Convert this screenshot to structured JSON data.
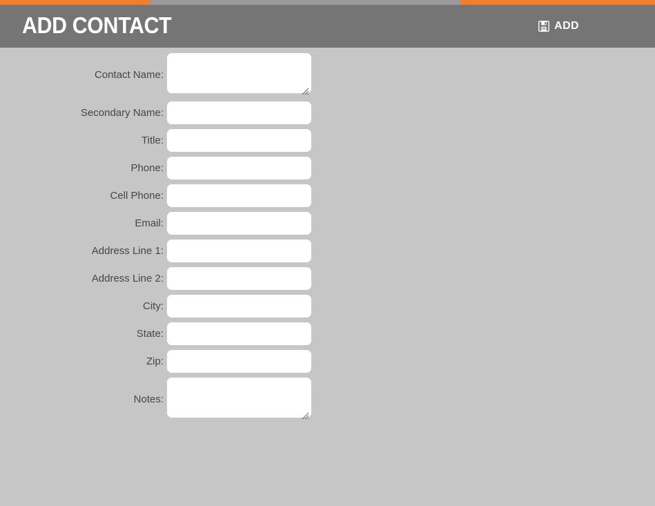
{
  "theme": {
    "accent_color": "#ef7e2e",
    "header_bg": "#757575",
    "body_bg": "#c6c6c6",
    "field_bg": "#ffffff",
    "label_color": "#454545",
    "title_color": "#ffffff"
  },
  "header": {
    "title": "ADD CONTACT",
    "action": {
      "icon": "save-floppy-icon",
      "label": "ADD"
    }
  },
  "form": {
    "fields": [
      {
        "label": "Contact Name:",
        "value": "",
        "placeholder": "",
        "type": "textarea"
      },
      {
        "label": "Secondary Name:",
        "value": "",
        "placeholder": "",
        "type": "text"
      },
      {
        "label": "Title:",
        "value": "",
        "placeholder": "",
        "type": "text"
      },
      {
        "label": "Phone:",
        "value": "",
        "placeholder": "",
        "type": "text"
      },
      {
        "label": "Cell Phone:",
        "value": "",
        "placeholder": "",
        "type": "text"
      },
      {
        "label": "Email:",
        "value": "",
        "placeholder": "",
        "type": "text"
      },
      {
        "label": "Address Line 1:",
        "value": "",
        "placeholder": "",
        "type": "text"
      },
      {
        "label": "Address Line 2:",
        "value": "",
        "placeholder": "",
        "type": "text"
      },
      {
        "label": "City:",
        "value": "",
        "placeholder": "",
        "type": "text"
      },
      {
        "label": "State:",
        "value": "",
        "placeholder": "",
        "type": "text"
      },
      {
        "label": "Zip:",
        "value": "",
        "placeholder": "",
        "type": "text"
      },
      {
        "label": "Notes:",
        "value": "",
        "placeholder": "",
        "type": "textarea"
      }
    ]
  }
}
